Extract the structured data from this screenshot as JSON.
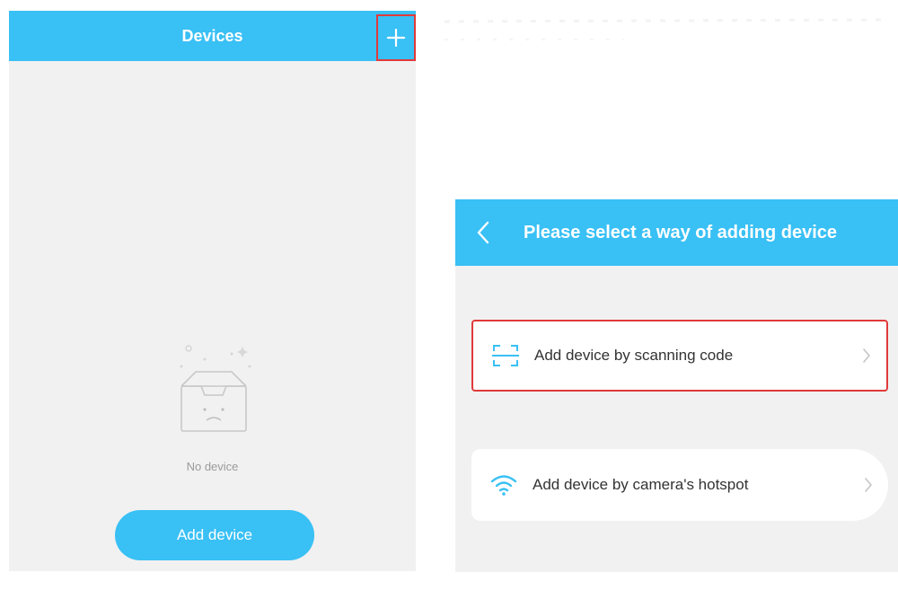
{
  "left_screen": {
    "header": {
      "title": "Devices"
    },
    "empty_state": {
      "text": "No device"
    },
    "add_device_button": {
      "label": "Add device"
    }
  },
  "right_screen": {
    "header": {
      "title": "Please select a way of adding device"
    },
    "options": [
      {
        "label": "Add device by scanning code",
        "icon": "scan-code-icon"
      },
      {
        "label": "Add device by camera's hotspot",
        "icon": "wifi-icon"
      }
    ]
  },
  "colors": {
    "brand_blue": "#39c0f5",
    "highlight_red": "#e03a3a",
    "panel_bg": "#f1f1f1"
  }
}
